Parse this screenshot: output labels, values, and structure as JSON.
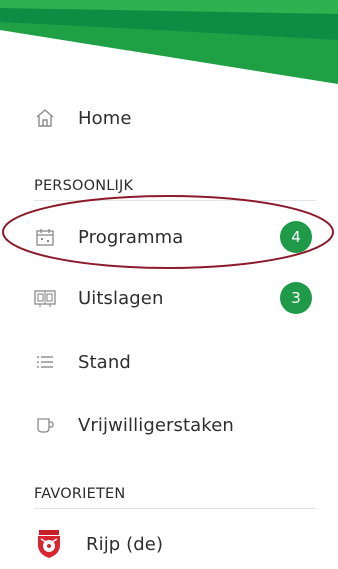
{
  "colors": {
    "brand_green": "#1e9a48",
    "annotation": "#8b1a2a"
  },
  "menu": {
    "home": {
      "label": "Home",
      "icon": "home-icon"
    },
    "personal_header": "PERSOONLIJK",
    "personal": [
      {
        "label": "Programma",
        "icon": "calendar-icon",
        "badge": "4"
      },
      {
        "label": "Uitslagen",
        "icon": "scoreboard-icon",
        "badge": "3"
      },
      {
        "label": "Stand",
        "icon": "list-icon"
      },
      {
        "label": "Vrijwilligerstaken",
        "icon": "cup-icon"
      }
    ],
    "favorites_header": "FAVORIETEN",
    "favorites": [
      {
        "label": "Rijp (de)",
        "icon": "club-crest-icon"
      }
    ]
  }
}
